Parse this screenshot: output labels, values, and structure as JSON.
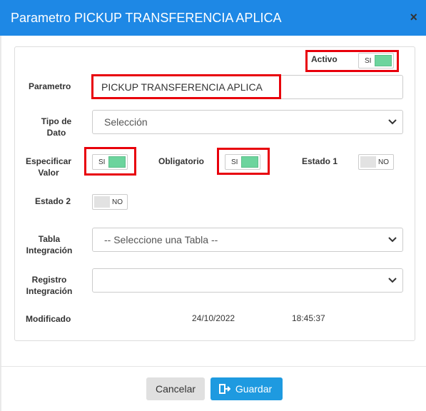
{
  "dialog": {
    "title": "Parametro PICKUP TRANSFERENCIA APLICA",
    "close_icon": "close-icon",
    "close_glyph": "×"
  },
  "form": {
    "activo": {
      "label": "Activo",
      "state": "SI",
      "on": true
    },
    "parametro": {
      "label": "Parametro",
      "value": "PICKUP TRANSFERENCIA APLICA"
    },
    "tipo_dato": {
      "label_line1": "Tipo de",
      "label_line2": "Dato",
      "selected": "Selección"
    },
    "especificar_valor": {
      "label_line1": "Especificar",
      "label_line2": "Valor",
      "state": "SI",
      "on": true
    },
    "obligatorio": {
      "label": "Obligatorio",
      "state": "SI",
      "on": true
    },
    "estado1": {
      "label": "Estado 1",
      "state": "NO",
      "on": false
    },
    "estado2": {
      "label": "Estado 2",
      "state": "NO",
      "on": false
    },
    "tabla_integracion": {
      "label_line1": "Tabla",
      "label_line2": "Integración",
      "selected": "-- Seleccione una Tabla --"
    },
    "registro_integracion": {
      "label_line1": "Registro",
      "label_line2": "Integración",
      "selected": ""
    },
    "modificado": {
      "label": "Modificado",
      "date": "24/10/2022",
      "time": "18:45:37"
    }
  },
  "footer": {
    "cancel_label": "Cancelar",
    "save_label": "Guardar",
    "save_icon": "save-icon"
  },
  "colors": {
    "header": "#1e88e5",
    "toggle_on": "#6cd49d",
    "highlight": "#e8000b",
    "save_button": "#1e9ae0"
  }
}
